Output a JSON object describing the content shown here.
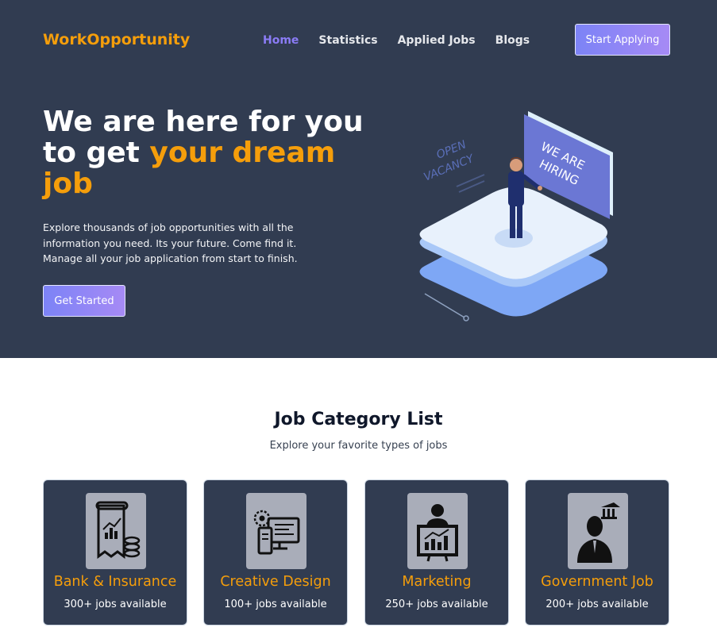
{
  "header": {
    "brand": "WorkOpportunity",
    "nav": [
      {
        "label": "Home",
        "active": true
      },
      {
        "label": "Statistics",
        "active": false
      },
      {
        "label": "Applied Jobs",
        "active": false
      },
      {
        "label": "Blogs",
        "active": false
      }
    ],
    "cta_label": "Start Applying"
  },
  "hero": {
    "headline_1": "We are here for you",
    "headline_2": "to get ",
    "headline_highlight": "your dream job",
    "description": "Explore thousands of job opportunities with all the information you need. Its your future. Come find it. Manage all your job application from start to finish.",
    "button_label": "Get Started",
    "illustration": {
      "sign_text_1": "WE ARE",
      "sign_text_2": "HIRING",
      "tag_text_1": "OPEN",
      "tag_text_2": "VACANCY"
    }
  },
  "categories": {
    "title": "Job Category List",
    "subtitle": "Explore your favorite types of jobs",
    "items": [
      {
        "name": "Bank & Insurance",
        "count": "300+ jobs available",
        "icon": "bank-insurance-icon"
      },
      {
        "name": "Creative Design",
        "count": "100+ jobs available",
        "icon": "creative-design-icon"
      },
      {
        "name": "Marketing",
        "count": "250+ jobs available",
        "icon": "marketing-icon"
      },
      {
        "name": "Government Job",
        "count": "200+ jobs available",
        "icon": "government-job-icon"
      }
    ]
  },
  "colors": {
    "dark_bg": "#313c51",
    "accent_orange": "#f59e0b",
    "accent_purple": "#8b7cf6"
  }
}
